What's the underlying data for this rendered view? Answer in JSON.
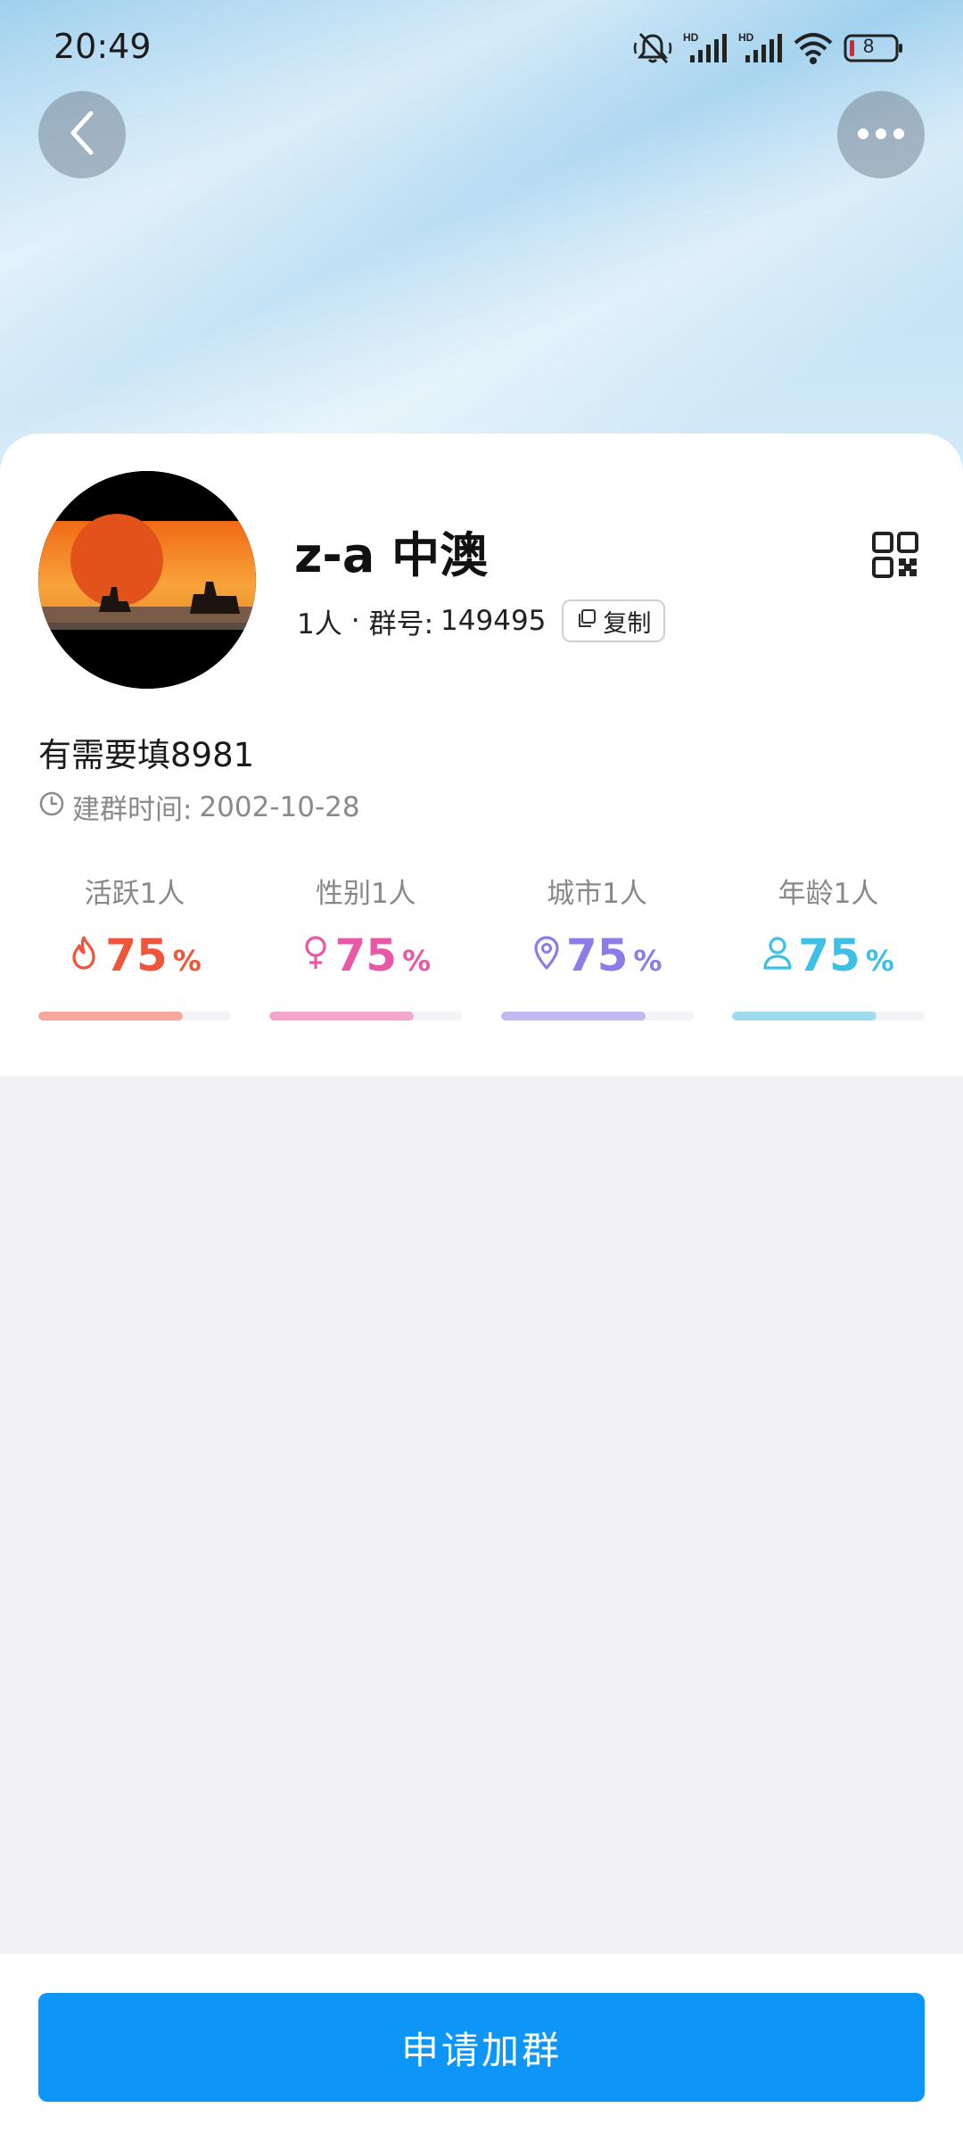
{
  "status_bar": {
    "time": "20:49",
    "battery": "8",
    "icons": [
      "mute-icon",
      "signal-hd-icon",
      "signal-hd-icon",
      "wifi-icon",
      "battery-icon"
    ]
  },
  "nav": {
    "back_icon": "chevron-left-icon",
    "more_icon": "more-dots-icon"
  },
  "group": {
    "name": "z-a 中澳",
    "members": "1人",
    "separator": "·",
    "id_label": "群号:",
    "id_value": "149495",
    "copy_label": "复制",
    "description": "有需要填8981",
    "created_label": "建群时间:",
    "created_date": "2002-10-28"
  },
  "stats": [
    {
      "label": "活跃1人",
      "value": "75",
      "unit": "%",
      "fraction": 0.75,
      "color": "#f0553a",
      "bar_color": "#f6a99a",
      "icon": "flame-icon"
    },
    {
      "label": "性别1人",
      "value": "75",
      "unit": "%",
      "fraction": 0.75,
      "color": "#e958a6",
      "bar_color": "#f4a6cf",
      "icon": "female-icon"
    },
    {
      "label": "城市1人",
      "value": "75",
      "unit": "%",
      "fraction": 0.75,
      "color": "#8f7be8",
      "bar_color": "#c3b9f4",
      "icon": "location-pin-icon"
    },
    {
      "label": "年龄1人",
      "value": "75",
      "unit": "%",
      "fraction": 0.75,
      "color": "#3dbfe6",
      "bar_color": "#9edbee",
      "icon": "person-icon"
    }
  ],
  "footer": {
    "join_label": "申请加群",
    "accent": "#0d95f8"
  }
}
